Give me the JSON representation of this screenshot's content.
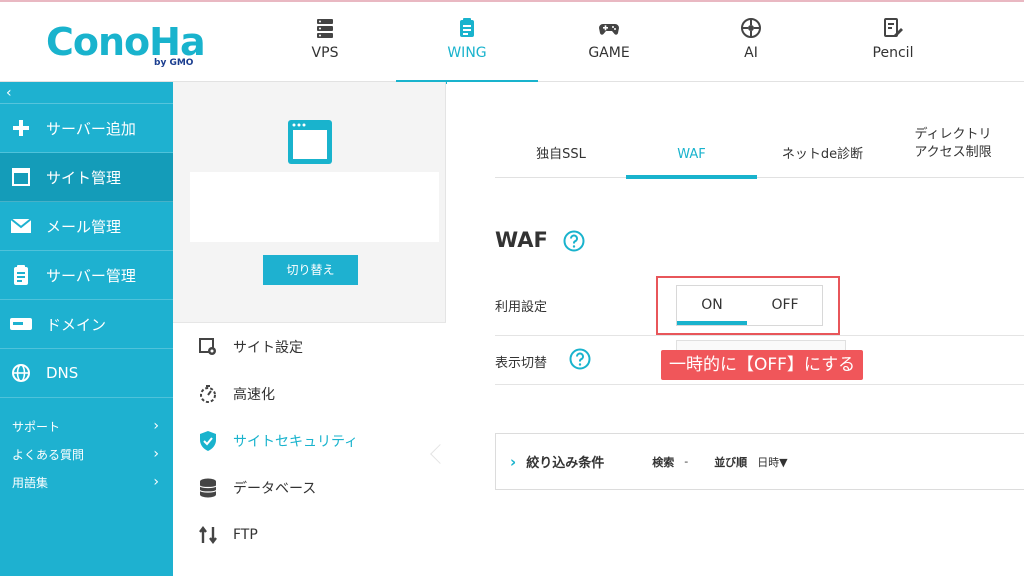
{
  "logo": {
    "brand": "ConoHa",
    "sub": "by GMO"
  },
  "topnav": [
    {
      "label": "VPS",
      "icon": "server-icon",
      "active": false
    },
    {
      "label": "WING",
      "icon": "wing-icon",
      "active": true
    },
    {
      "label": "GAME",
      "icon": "gamepad-icon",
      "active": false
    },
    {
      "label": "AI",
      "icon": "ai-chip-icon",
      "active": false
    },
    {
      "label": "Pencil",
      "icon": "pencil-edit-icon",
      "active": false
    }
  ],
  "sidebar": {
    "collapse": "‹",
    "items": [
      {
        "label": "サーバー追加",
        "icon": "plus-icon"
      },
      {
        "label": "サイト管理",
        "icon": "window-icon",
        "active": true
      },
      {
        "label": "メール管理",
        "icon": "mail-icon"
      },
      {
        "label": "サーバー管理",
        "icon": "server-manage-icon"
      },
      {
        "label": "ドメイン",
        "icon": "domain-icon"
      },
      {
        "label": "DNS",
        "icon": "globe-icon"
      }
    ],
    "links": [
      {
        "label": "サポート",
        "chevron": "›"
      },
      {
        "label": "よくある質問",
        "chevron": "›"
      },
      {
        "label": "用語集",
        "chevron": "›"
      }
    ]
  },
  "midcol": {
    "switch_label": "切り替え",
    "submenu": [
      {
        "label": "サイト設定",
        "icon": "site-settings-icon"
      },
      {
        "label": "高速化",
        "icon": "speed-icon"
      },
      {
        "label": "サイトセキュリティ",
        "icon": "shield-check-icon",
        "active": true
      },
      {
        "label": "データベース",
        "icon": "database-icon"
      },
      {
        "label": "FTP",
        "icon": "transfer-arrows-icon"
      }
    ]
  },
  "tabs": [
    {
      "label": "独自SSL"
    },
    {
      "label": "WAF",
      "active": true
    },
    {
      "label": "ネットde診断"
    },
    {
      "label_line1": "ディレクトリ",
      "label_line2": "アクセス制限"
    }
  ],
  "section": {
    "title": "WAF"
  },
  "rows": {
    "usage_label": "利用設定",
    "display_label": "表示切替",
    "toggle_on": "ON",
    "toggle_off": "OFF",
    "toggle_selected": "ON"
  },
  "callout": "一時的に【OFF】にする",
  "filter": {
    "chevron": "›",
    "label": "絞り込み条件",
    "search_key": "検索",
    "search_val": "-",
    "sort_key": "並び順",
    "sort_val": "日時▼"
  },
  "colors": {
    "accent": "#19b3cd",
    "sidebar": "#1eb1d0",
    "highlight": "#e8565a",
    "callout": "#f0565a"
  }
}
